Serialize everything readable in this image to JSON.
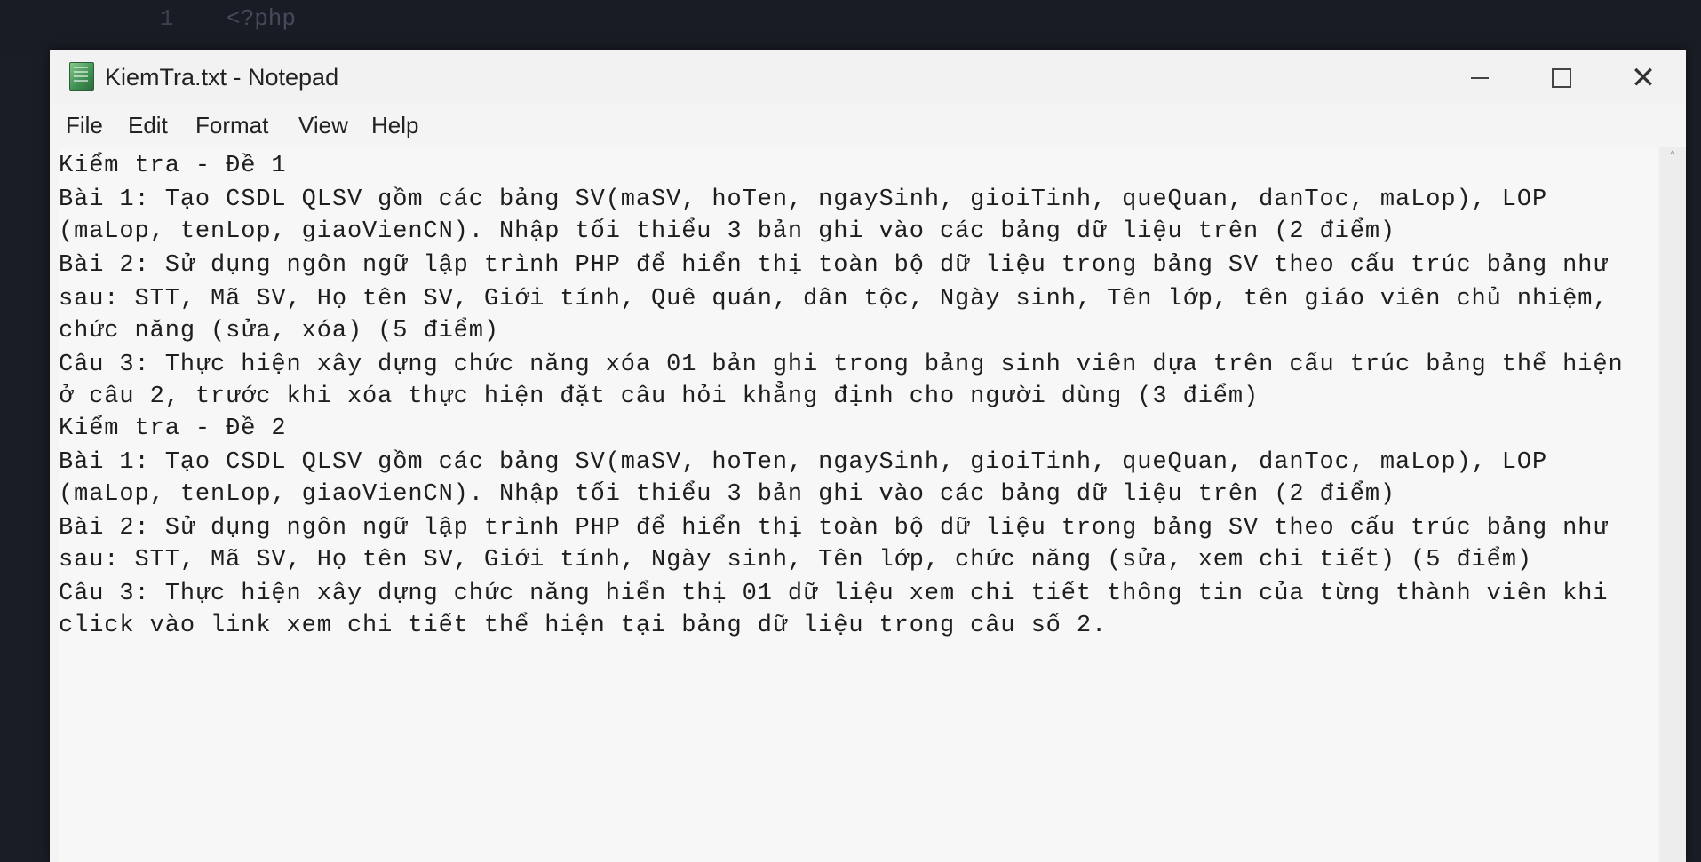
{
  "background": {
    "line_number": "1",
    "code_text": "<?php"
  },
  "window": {
    "title": "KiemTra.txt - Notepad",
    "controls": {
      "minimize": "minimize-icon",
      "maximize": "maximize-icon",
      "close": "close-icon",
      "close_glyph": "✕"
    }
  },
  "menu": {
    "file": "File",
    "edit": "Edit",
    "format": "Format",
    "view": "View",
    "help": "Help"
  },
  "document": {
    "lines": [
      "Kiểm tra - Đề 1",
      "Bài 1: Tạo CSDL QLSV gồm các bảng SV(maSV, hoTen, ngaySinh, gioiTinh, queQuan, danToc, maLop), LOP",
      "(maLop, tenLop, giaoVienCN). Nhập tối thiểu 3 bản ghi vào các bảng dữ liệu trên (2 điểm)",
      "Bài 2: Sử dụng ngôn ngữ lập trình PHP để hiển thị toàn bộ dữ liệu trong bảng SV theo cấu trúc bảng như",
      "sau: STT, Mã SV, Họ tên SV, Giới tính, Quê quán, dân tộc, Ngày sinh, Tên lớp, tên giáo viên chủ nhiệm,",
      "chức năng (sửa, xóa) (5 điểm)",
      "Câu 3: Thực hiện xây dựng chức năng xóa 01 bản ghi trong bảng sinh viên dựa trên cấu trúc bảng thể hiện",
      "ở câu 2, trước khi xóa thực hiện đặt câu hỏi khẳng định cho người dùng (3 điểm)",
      "Kiểm tra - Đề 2",
      "Bài 1: Tạo CSDL QLSV gồm các bảng SV(maSV, hoTen, ngaySinh, gioiTinh, queQuan, danToc, maLop), LOP",
      "(maLop, tenLop, giaoVienCN). Nhập tối thiểu 3 bản ghi vào các bảng dữ liệu trên (2 điểm)",
      "Bài 2: Sử dụng ngôn ngữ lập trình PHP để hiển thị toàn bộ dữ liệu trong bảng SV theo cấu trúc bảng như",
      "sau: STT, Mã SV, Họ tên SV, Giới tính, Ngày sinh, Tên lớp, chức năng (sửa, xem chi tiết) (5 điểm)",
      "Câu 3: Thực hiện xây dựng chức năng hiển thị 01 dữ liệu xem chi tiết thông tin của từng thành viên khi",
      "click vào link xem chi tiết thể hiện tại bảng dữ liệu trong câu số 2."
    ]
  },
  "scrollbar": {
    "up_glyph": "˄"
  }
}
